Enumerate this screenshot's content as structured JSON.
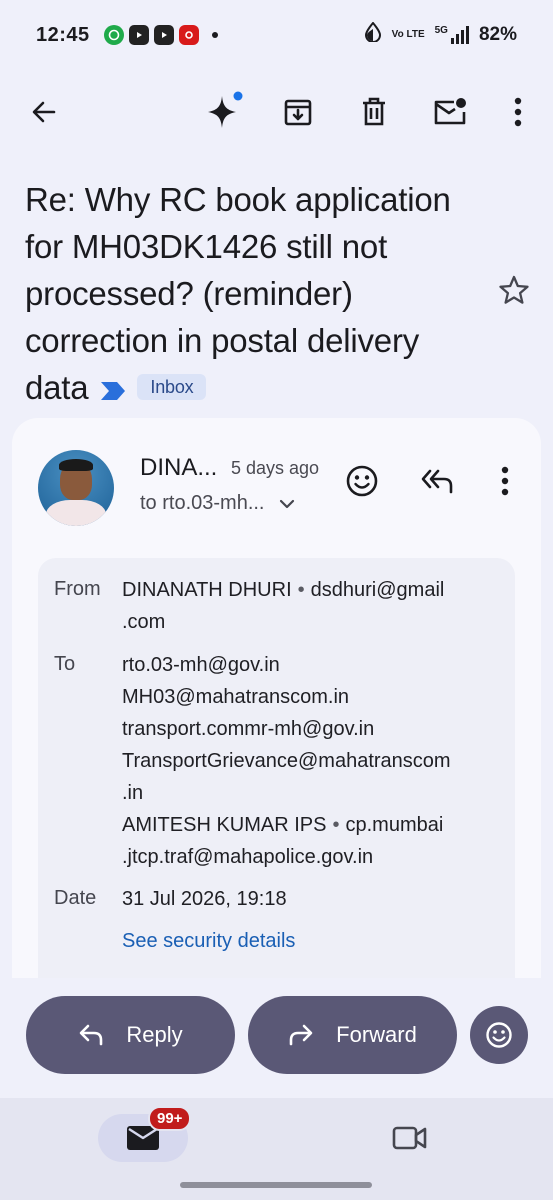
{
  "status_bar": {
    "time": "12:45",
    "network": "Vo LTE",
    "network_gen": "5G",
    "battery": "82%",
    "notification_icons": [
      "whatsapp-icon",
      "youtube-icon",
      "youtube-icon",
      "app-icon"
    ]
  },
  "toolbar": {
    "icons": [
      "back-arrow-icon",
      "gemini-sparkle-icon",
      "archive-icon",
      "delete-icon",
      "mark-unread-icon",
      "more-vert-icon"
    ]
  },
  "email": {
    "subject": "Re: Why RC book application for MH03DK1426 still not processed? (reminder) correction in postal delivery data",
    "label": "Inbox",
    "sender_short": "DINA...",
    "time_ago": "5 days ago",
    "to_short": "to rto.03-mh...",
    "details": {
      "from_label": "From",
      "from_name": "DINANATH DHURI",
      "from_email": "dsdhuri@gmail.com",
      "from_email_line1": "dsdhuri@gmail",
      "from_email_line2": ".com",
      "to_label": "To",
      "to": [
        "rto.03-mh@gov.in",
        "MH03@mahatranscom.in",
        "transport.commr-mh@gov.in",
        "TransportGrievance@mahatranscom",
        ".in"
      ],
      "to_named": {
        "name": "AMITESH KUMAR IPS",
        "email_line1": "cp.mumbai",
        "email_line2": ".jtcp.traf@mahapolice.gov.in"
      },
      "date_label": "Date",
      "date": "31 Jul 2026, 19:18",
      "security_link": "See security details"
    }
  },
  "actions": {
    "reply": "Reply",
    "forward": "Forward"
  },
  "bottom_nav": {
    "mail_badge": "99+"
  },
  "colors": {
    "background": "#eff0fa",
    "action_button": "#5a5876",
    "link": "#1a5fb4",
    "inbox_chip": "#dbe3f7",
    "label_chevron": "#2a6fdb",
    "badge": "#c11c1c"
  }
}
